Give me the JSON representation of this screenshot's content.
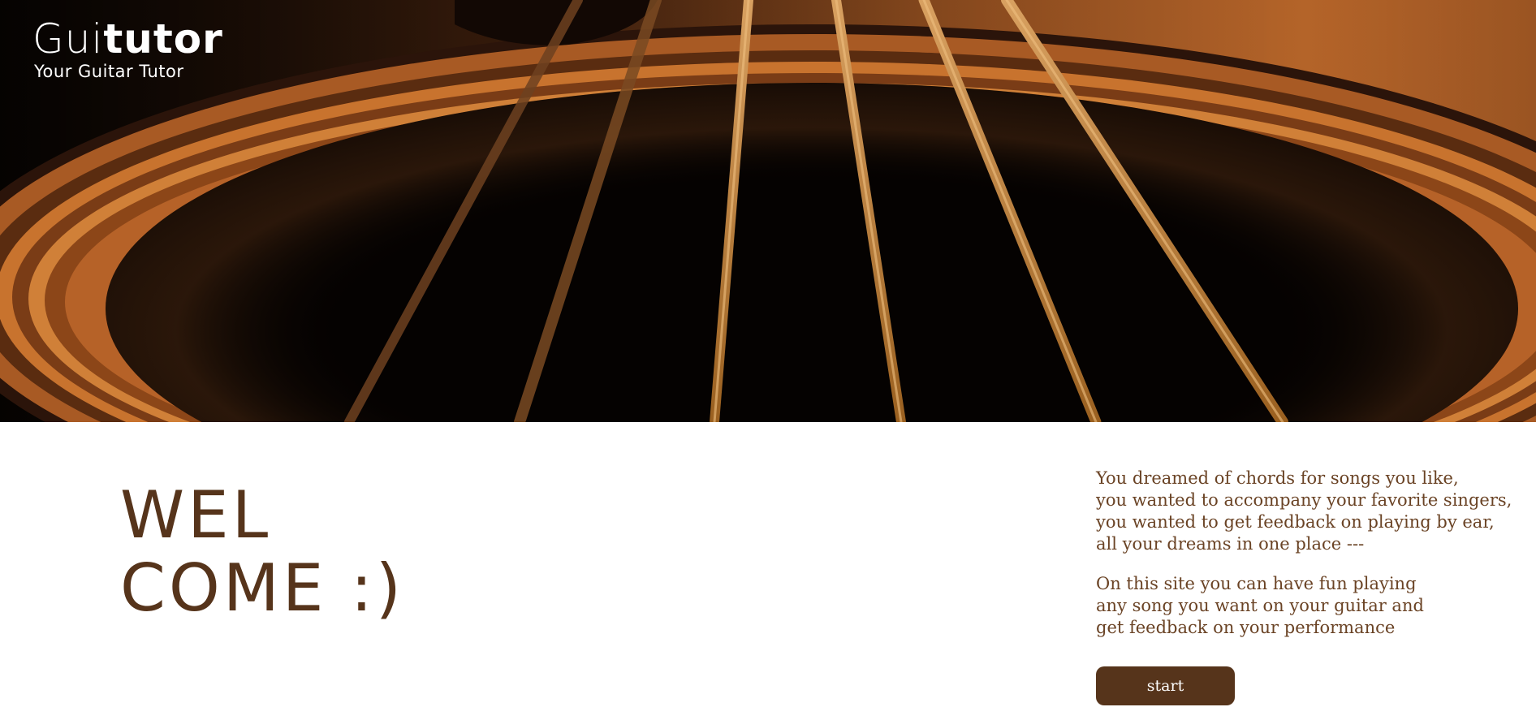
{
  "brand": {
    "name_light": "Gui",
    "name_bold": "tutor",
    "tagline": "Your Guitar Tutor"
  },
  "hero": {
    "image": "acoustic-guitar-soundhole-strings-photo"
  },
  "welcome": {
    "line1": "WEL",
    "line2": "COME :)"
  },
  "intro": {
    "paragraph1": [
      "You dreamed of chords for songs you like,",
      "you wanted to accompany your favorite singers,",
      "you wanted to get feedback on playing by ear,",
      "all your dreams in one place ---"
    ],
    "paragraph2": [
      "On this site you can have fun playing",
      "any song you want on your guitar and",
      "get feedback on your performance"
    ]
  },
  "actions": {
    "start_label": "start"
  },
  "colors": {
    "accent": "#56341b",
    "text": "#6a4325",
    "background": "#ffffff"
  }
}
